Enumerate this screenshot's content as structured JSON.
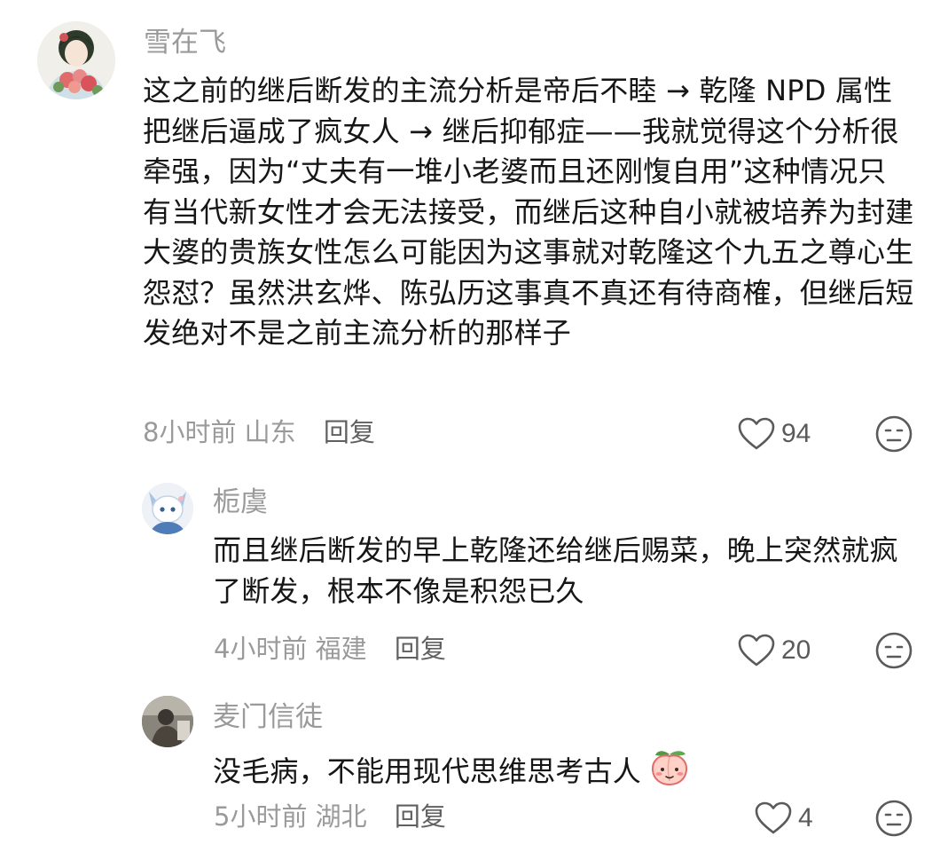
{
  "comments": [
    {
      "username": "雪在飞",
      "text": "这之前的继后断发的主流分析是帝后不睦 → 乾隆 NPD 属性把继后逼成了疯女人 → 继后抑郁症——我就觉得这个分析很牵强，因为“丈夫有一堆小老婆而且还刚愎自用”这种情况只有当代新女性才会无法接受，而继后这种自小就被培养为封建大婆的贵族女性怎么可能因为这事就对乾隆这个九五之尊心生怨怼？虽然洪玄烨、陈弘历这事真不真还有待商榷，但继后短发绝对不是之前主流分析的那样子",
      "time": "8小时前",
      "location": "山东",
      "reply_label": "回复",
      "likes": "94",
      "icons": {
        "like": "heart-outline-icon",
        "dislike": "dislike-face-icon"
      }
    },
    {
      "username": "栀虞",
      "text": "而且继后断发的早上乾隆还给继后赐菜，晚上突然就疯了断发，根本不像是积怨已久",
      "time": "4小时前",
      "location": "福建",
      "reply_label": "回复",
      "likes": "20",
      "icons": {
        "like": "heart-outline-icon",
        "dislike": "dislike-face-icon"
      }
    },
    {
      "username": "麦门信徒",
      "text": "没毛病，不能用现代思维思考古人",
      "emoji": "peach-face-emoji",
      "time": "5小时前",
      "location": "湖北",
      "reply_label": "回复",
      "likes": "4",
      "icons": {
        "like": "heart-outline-icon",
        "dislike": "dislike-face-icon"
      }
    }
  ]
}
